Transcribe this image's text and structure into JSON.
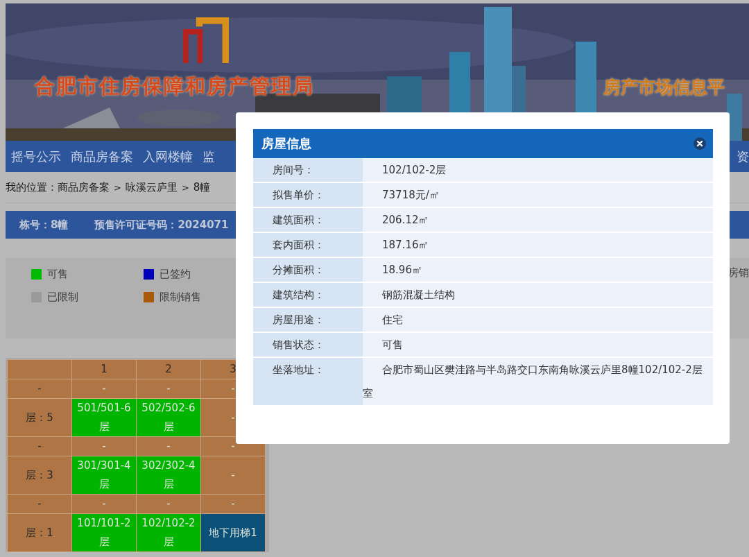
{
  "banner": {
    "title": "合肥市住房保障和房产管理局",
    "subtitle": "房产市场信息平"
  },
  "nav": [
    {
      "label": "摇号公示"
    },
    {
      "label": "商品房备案"
    },
    {
      "label": "入网楼幢"
    },
    {
      "label": "监"
    },
    {
      "label": "资"
    }
  ],
  "breadcrumb": {
    "prefix": "我的位置：",
    "separator": ">",
    "items": [
      "商品房备案",
      "咏溪云庐里",
      "8幢"
    ]
  },
  "info_bar": [
    "栋号：8幢",
    "预售许可证号码：2024071"
  ],
  "legend": [
    {
      "label": "可售",
      "color": "#00bb00"
    },
    {
      "label": "已签约",
      "color": "#0000bb"
    },
    {
      "label": "已限制",
      "color": "#9a9a9a"
    },
    {
      "label": "限制销售",
      "color": "#a85a08"
    }
  ],
  "legend_extra": "房销",
  "grid": {
    "columns": [
      "1",
      "2",
      "3"
    ],
    "rows": [
      {
        "label": "-",
        "cells": [
          {
            "text": "-",
            "color": "#b07545"
          },
          {
            "text": "-",
            "color": "#b07545"
          },
          {
            "text": "-",
            "color": "#b07545"
          }
        ]
      },
      {
        "label": "层：5",
        "cells": [
          {
            "text": "501/501-6层",
            "color": "#00b400"
          },
          {
            "text": "502/502-6层",
            "color": "#00b400"
          },
          {
            "text": "-",
            "color": "#b07545"
          }
        ]
      },
      {
        "label": "-",
        "cells": [
          {
            "text": "-",
            "color": "#b07545"
          },
          {
            "text": "-",
            "color": "#b07545"
          },
          {
            "text": "-",
            "color": "#b07545"
          }
        ]
      },
      {
        "label": "层：3",
        "cells": [
          {
            "text": "301/301-4层",
            "color": "#00b400"
          },
          {
            "text": "302/302-4层",
            "color": "#00b400"
          },
          {
            "text": "-",
            "color": "#b07545"
          }
        ]
      },
      {
        "label": "-",
        "cells": [
          {
            "text": "-",
            "color": "#b07545"
          },
          {
            "text": "-",
            "color": "#b07545"
          },
          {
            "text": "-",
            "color": "#b07545"
          }
        ]
      },
      {
        "label": "层：1",
        "cells": [
          {
            "text": "101/101-2层",
            "color": "#00b400"
          },
          {
            "text": "102/102-2层",
            "color": "#00b400"
          },
          {
            "text": "地下用梯1",
            "color": "#0a5078"
          }
        ]
      }
    ]
  },
  "dialog": {
    "title": "房屋信息",
    "fields": [
      {
        "label": "房间号：",
        "value": "102/102-2层"
      },
      {
        "label": "拟售单价：",
        "value": "73718元/㎡"
      },
      {
        "label": "建筑面积：",
        "value": "206.12㎡"
      },
      {
        "label": "套内面积：",
        "value": "187.16㎡"
      },
      {
        "label": "分摊面积：",
        "value": "18.96㎡"
      },
      {
        "label": "建筑结构：",
        "value": "钢筋混凝土结构"
      },
      {
        "label": "房屋用途：",
        "value": "住宅"
      },
      {
        "label": "销售状态：",
        "value": "可售"
      },
      {
        "label": "坐落地址：",
        "value": "合肥市蜀山区樊洼路与半岛路交口东南角咏溪云庐里8幢102/102-2层室"
      }
    ]
  }
}
